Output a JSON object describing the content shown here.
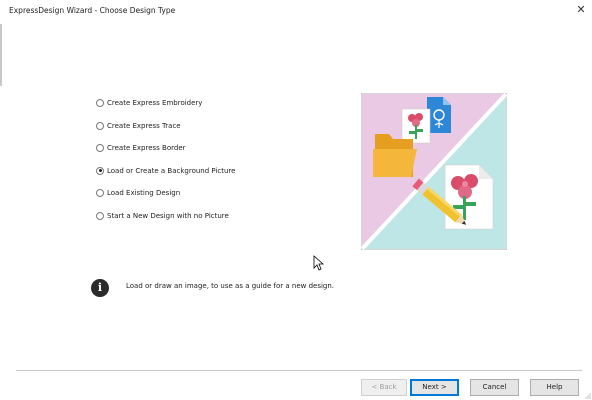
{
  "window": {
    "title": "ExpressDesign Wizard - Choose Design Type",
    "close_icon": "close-icon"
  },
  "options": [
    {
      "label": "Create Express Embroidery",
      "selected": false
    },
    {
      "label": "Create Express Trace",
      "selected": false
    },
    {
      "label": "Create Express Border",
      "selected": false
    },
    {
      "label": "Load or Create a Background Picture",
      "selected": true
    },
    {
      "label": "Load Existing Design",
      "selected": false
    },
    {
      "label": "Start a New Design with no Picture",
      "selected": false
    }
  ],
  "info": {
    "icon": "info-icon",
    "text": "Load or draw an image, to use as a guide for a new design."
  },
  "buttons": {
    "back": "< Back",
    "next": "Next >",
    "cancel": "Cancel",
    "help": "Help"
  },
  "colors": {
    "illustration_pink": "#e9c9e3",
    "illustration_teal": "#bfe6e6",
    "folder": "#f2b233",
    "flower_red": "#d94c6a",
    "leaf_green": "#3aa35a",
    "default_button_border": "#0078d7"
  }
}
